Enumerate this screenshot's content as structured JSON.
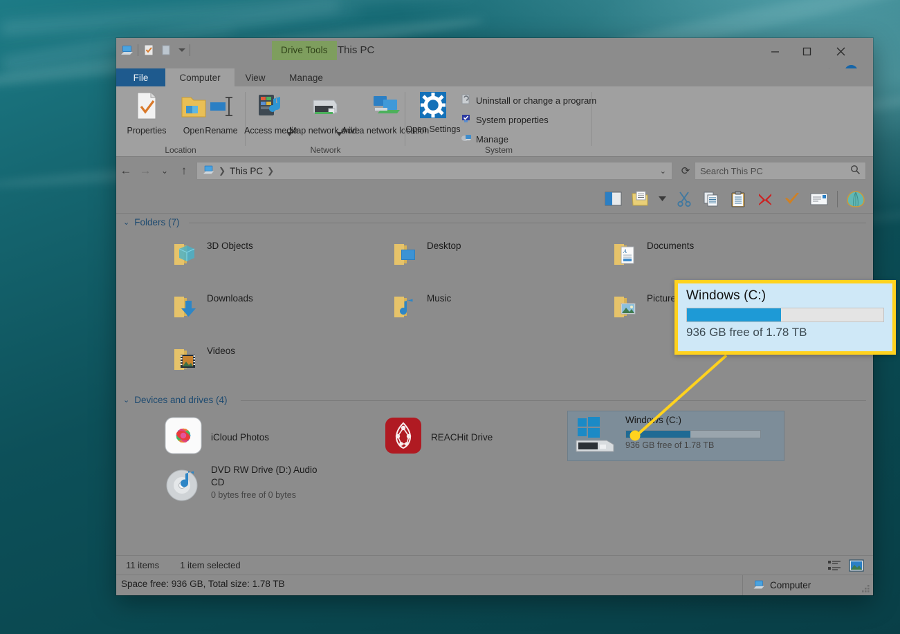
{
  "window": {
    "title": "This PC",
    "contextual_tab": "Drive Tools",
    "controls": {
      "minimize": "Minimize",
      "maximize": "Maximize",
      "close": "Close",
      "help": "?"
    },
    "quick_access": [
      "this-pc-icon",
      "properties-icon",
      "new-folder-icon",
      "customize-caret"
    ]
  },
  "tabs": [
    {
      "label": "File",
      "active": false,
      "kind": "file"
    },
    {
      "label": "Computer",
      "active": true,
      "kind": "normal"
    },
    {
      "label": "View",
      "active": false,
      "kind": "normal"
    },
    {
      "label": "Manage",
      "active": false,
      "kind": "normal"
    }
  ],
  "ribbon": {
    "groups": [
      {
        "title": "Location",
        "buttons": [
          {
            "label": "Properties",
            "icon": "properties-icon"
          },
          {
            "label": "Open",
            "icon": "open-folder-icon"
          },
          {
            "label": "Rename",
            "icon": "rename-icon"
          }
        ]
      },
      {
        "title": "Network",
        "buttons": [
          {
            "label": "Access media",
            "icon": "access-media-icon",
            "has_menu": true
          },
          {
            "label": "Map network drive",
            "icon": "map-network-drive-icon",
            "has_menu": true
          },
          {
            "label": "Add a network location",
            "icon": "add-network-location-icon",
            "has_menu": false
          }
        ]
      },
      {
        "title": "System",
        "buttons": [
          {
            "label": "Open Settings",
            "icon": "settings-gear-icon"
          }
        ],
        "items": [
          {
            "label": "Uninstall or change a program",
            "icon": "uninstall-icon"
          },
          {
            "label": "System properties",
            "icon": "system-properties-icon"
          },
          {
            "label": "Manage",
            "icon": "manage-icon"
          }
        ]
      }
    ]
  },
  "navigation": {
    "back": "Back",
    "forward": "Forward",
    "recent": "Recent locations",
    "up": "Up",
    "breadcrumb": {
      "icon": "this-pc-icon",
      "path": "This PC"
    },
    "refresh": "Refresh"
  },
  "search": {
    "placeholder": "Search This PC",
    "value": "",
    "icon": "search-icon"
  },
  "toolbar_icons": [
    {
      "name": "preview-pane-icon",
      "label": "Preview pane"
    },
    {
      "name": "new-folder-icon",
      "label": "New folder"
    },
    {
      "name": "dropdown-caret-icon",
      "label": "More"
    },
    {
      "name": "cut-icon",
      "label": "Cut"
    },
    {
      "name": "copy-icon",
      "label": "Copy"
    },
    {
      "name": "paste-icon",
      "label": "Paste"
    },
    {
      "name": "delete-icon",
      "label": "Delete"
    },
    {
      "name": "check-icon",
      "label": "Select"
    },
    {
      "name": "email-icon",
      "label": "Email"
    },
    {
      "name": "shell-icon",
      "label": "Shell extension"
    }
  ],
  "sections": [
    {
      "id": "folders",
      "title": "Folders (7)",
      "items": [
        {
          "name": "3D Objects",
          "icon": "folder-3d-objects-icon"
        },
        {
          "name": "Desktop",
          "icon": "folder-desktop-icon"
        },
        {
          "name": "Documents",
          "icon": "folder-documents-icon"
        },
        {
          "name": "Downloads",
          "icon": "folder-downloads-icon"
        },
        {
          "name": "Music",
          "icon": "folder-music-icon"
        },
        {
          "name": "Pictures",
          "icon": "folder-pictures-icon"
        },
        {
          "name": "Videos",
          "icon": "folder-videos-icon"
        }
      ]
    },
    {
      "id": "devices",
      "title": "Devices and drives (4)",
      "items": [
        {
          "name": "iCloud Photos",
          "icon": "icloud-photos-icon",
          "sub": "",
          "selected": false
        },
        {
          "name": "REACHit Drive",
          "icon": "reachit-drive-icon",
          "sub": "",
          "selected": false
        },
        {
          "name": "Windows (C:)",
          "icon": "windows-drive-icon",
          "sub": "936 GB free of 1.78 TB",
          "selected": true,
          "used_percent": 48
        },
        {
          "name": "DVD RW Drive (D:) Audio CD",
          "icon": "dvd-drive-icon",
          "sub": "0 bytes free of 0 bytes",
          "selected": false
        }
      ]
    }
  ],
  "status": {
    "item_count": "11 items",
    "selection": "1 item selected",
    "details_view": "details-view-icon",
    "large_icons_view": "large-icons-view-icon"
  },
  "bottom_bar": {
    "label": "Computer",
    "icon": "computer-icon"
  },
  "callout": {
    "title": "Windows (C:)",
    "free_text": "936 GB free of 1.78 TB",
    "used_percent": 48
  },
  "detail_strip": {
    "text": "Space free: 936 GB, Total size: 1.78 TB"
  },
  "colors": {
    "highlight_border": "#ffd21e",
    "callout_bg": "#cfe8f7",
    "meter_fill": "#1e9ad6",
    "file_tab": "#1e5a8e",
    "contextual_tab": "#7e9e5e",
    "desktop": "#0d5059"
  }
}
